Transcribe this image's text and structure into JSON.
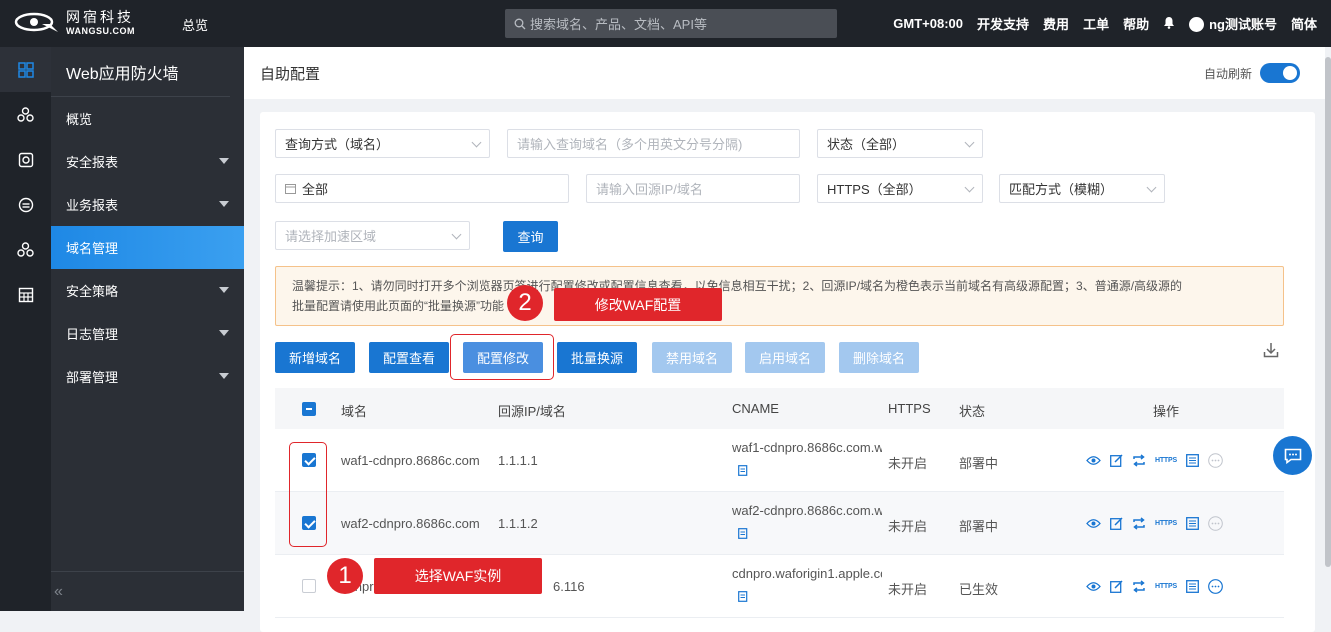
{
  "topbar": {
    "logo_cn": "网宿科技",
    "logo_en": "WANGSU.COM",
    "overview": "总览",
    "search_placeholder": "搜索域名、产品、文档、API等",
    "timezone": "GMT+08:00",
    "dev_support": "开发支持",
    "fees": "费用",
    "tickets": "工单",
    "help": "帮助",
    "account": "ng测试账号",
    "language": "简体"
  },
  "sidebar": {
    "title": "Web应用防火墙",
    "items": [
      {
        "label": "概览",
        "caret": false,
        "active": false
      },
      {
        "label": "安全报表",
        "caret": true,
        "active": false
      },
      {
        "label": "业务报表",
        "caret": true,
        "active": false
      },
      {
        "label": "域名管理",
        "caret": false,
        "active": true
      },
      {
        "label": "安全策略",
        "caret": true,
        "active": false
      },
      {
        "label": "日志管理",
        "caret": true,
        "active": false
      },
      {
        "label": "部署管理",
        "caret": true,
        "active": false
      }
    ],
    "collapse_glyph": "«"
  },
  "page": {
    "title": "自助配置",
    "auto_refresh": "自动刷新"
  },
  "filters": {
    "query_mode": "查询方式（域名）",
    "domain_placeholder": "请输入查询域名（多个用英文分号分隔)",
    "status": "状态（全部）",
    "date": "全部",
    "origin_placeholder": "请输入回源IP/域名",
    "https": "HTTPS（全部）",
    "match_mode": "匹配方式（模糊）",
    "region_placeholder": "请选择加速区域",
    "query_button": "查询"
  },
  "tip": {
    "line1": "温馨提示：1、请勿同时打开多个浏览器页签进行配置修改或配置信息查看，以免信息相互干扰；2、回源IP/域名为橙色表示当前域名有高级源配置；3、普通源/高级源的",
    "line2": "批量配置请使用此页面的“批量换源”功能"
  },
  "actions": {
    "add": "新增域名",
    "view": "配置查看",
    "modify": "配置修改",
    "batch_origin": "批量换源",
    "disable": "禁用域名",
    "enable": "启用域名",
    "delete": "删除域名"
  },
  "table": {
    "headers": {
      "domain": "域名",
      "origin": "回源IP/域名",
      "cname": "CNAME",
      "https": "HTTPS",
      "status": "状态",
      "ops": "操作"
    },
    "rows": [
      {
        "domain": "waf1-cdnpro.8686c.com",
        "origin": "1.1.1.1",
        "cname": "waf1-cdnpro.8686c.com.w",
        "https": "未开启",
        "status": "部署中",
        "checked": true
      },
      {
        "domain": "waf2-cdnpro.8686c.com",
        "origin": "1.1.1.2",
        "cname": "waf2-cdnpro.8686c.com.w",
        "https": "未开启",
        "status": "部署中",
        "checked": true
      },
      {
        "domain": "cdnpro",
        "origin": "6.116",
        "cname": "cdnpro.waforigin1.apple.cc",
        "https": "未开启",
        "status": "已生效",
        "checked": false
      }
    ]
  },
  "annotations": {
    "step1_num": "1",
    "step1_label": "选择WAF实例",
    "step2_num": "2",
    "step2_label": "修改WAF配置"
  },
  "colors": {
    "primary": "#1976d2",
    "annotation_red": "#e0262b",
    "topbar": "#1f2329"
  }
}
